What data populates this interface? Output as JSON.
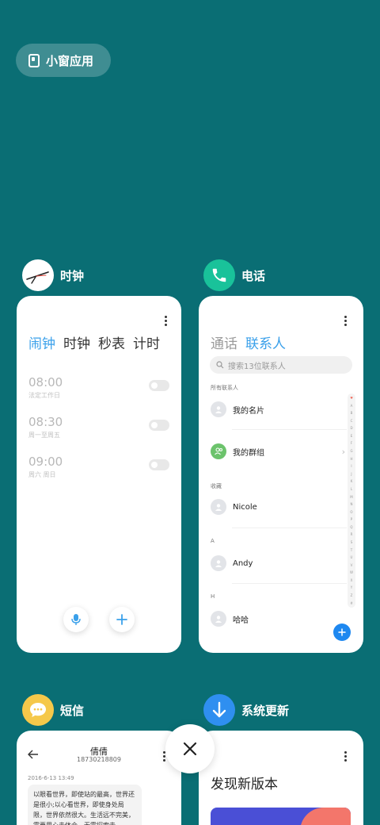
{
  "floating_window": {
    "label": "小窗应用",
    "icon": "small-window-icon"
  },
  "apps": {
    "clock": {
      "name": "时钟",
      "icon": "clock-icon",
      "tabs": [
        "闹钟",
        "时钟",
        "秒表",
        "计时"
      ],
      "active_tab": "闹钟",
      "alarms": [
        {
          "time": "08:00",
          "repeat": "法定工作日",
          "enabled": false
        },
        {
          "time": "08:30",
          "repeat": "周一至周五",
          "enabled": false
        },
        {
          "time": "09:00",
          "repeat": "周六 周日",
          "enabled": false
        }
      ]
    },
    "phone": {
      "name": "电话",
      "icon": "phone-icon",
      "tabs": [
        "通话",
        "联系人"
      ],
      "active_tab": "联系人",
      "search_placeholder": "搜索13位联系人",
      "all_contacts_label": "所有联系人",
      "my_card": "我的名片",
      "my_groups": "我的群组",
      "favorites_label": "收藏",
      "favorite_contact": "Nicole",
      "section_a": "A",
      "contact_a": "Andy",
      "section_h": "H",
      "contact_h": "哈哈",
      "alphabet": [
        "♥",
        "A",
        "B",
        "C",
        "D",
        "E",
        "F",
        "G",
        "H",
        "I",
        "J",
        "K",
        "L",
        "M",
        "N",
        "O",
        "P",
        "Q",
        "R",
        "S",
        "T",
        "U",
        "V",
        "W",
        "X",
        "Y",
        "Z",
        "#"
      ]
    },
    "sms": {
      "name": "短信",
      "icon": "message-icon",
      "contact_name": "倩倩",
      "contact_number": "18730218809",
      "timestamp": "2016-6-13 13:49",
      "message": "以眼看世界，即使站的最高，世界还是很小;以心看世界，即使身处局限，世界依然很大。生活远不完美，需要用心去体会，无需探索去"
    },
    "update": {
      "name": "系统更新",
      "icon": "download-icon",
      "headline": "发现新版本"
    }
  },
  "colors": {
    "background": "#0a6e74",
    "accent_blue": "#3aa0ea",
    "fab_blue": "#1e88f0",
    "phone_green": "#19c29a",
    "sms_yellow": "#f5c84a",
    "update_blue": "#2f8ff0"
  }
}
